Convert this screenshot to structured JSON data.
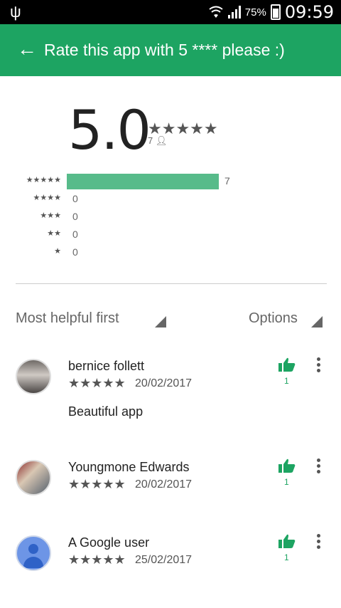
{
  "status_bar": {
    "battery_percent": "75%",
    "time": "09:59"
  },
  "app_bar": {
    "title": "Rate this app with 5 **** please :)"
  },
  "rating_summary": {
    "average": "5.0",
    "stars": "★★★★★",
    "count": "7"
  },
  "histogram": [
    {
      "stars": "★★★★★",
      "count": "7",
      "fraction": 1.0
    },
    {
      "stars": "★★★★",
      "count": "0",
      "fraction": 0
    },
    {
      "stars": "★★★",
      "count": "0",
      "fraction": 0
    },
    {
      "stars": "★★",
      "count": "0",
      "fraction": 0
    },
    {
      "stars": "★",
      "count": "0",
      "fraction": 0
    }
  ],
  "sort": {
    "label": "Most helpful first",
    "options_label": "Options"
  },
  "reviews": [
    {
      "name": "bernice follett",
      "stars": "★★★★★",
      "date": "20/02/2017",
      "text": "Beautiful app",
      "helpful": "1"
    },
    {
      "name": "Youngmone Edwards",
      "stars": "★★★★★",
      "date": "20/02/2017",
      "text": "",
      "helpful": "1"
    },
    {
      "name": "A Google user",
      "stars": "★★★★★",
      "date": "25/02/2017",
      "text": "",
      "helpful": "1"
    }
  ],
  "colors": {
    "accent": "#1da462",
    "bar": "#57bb8a"
  }
}
